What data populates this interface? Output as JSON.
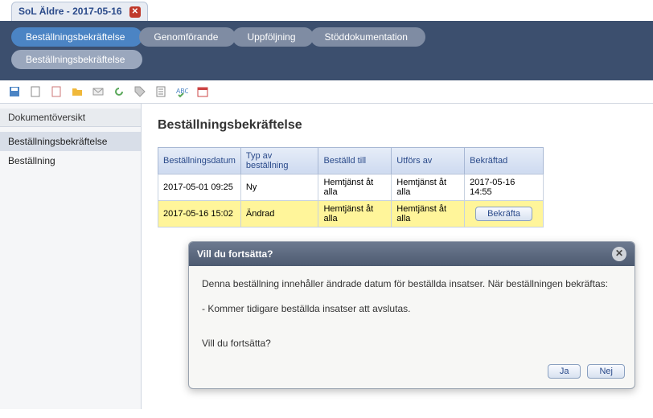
{
  "window": {
    "title": "SoL Äldre - 2017-05-16"
  },
  "nav": {
    "row1": [
      {
        "label": "Beställningsbekräftelse",
        "active": true
      },
      {
        "label": "Genomförande"
      },
      {
        "label": "Uppföljning"
      },
      {
        "label": "Stöddokumentation"
      }
    ],
    "row2": [
      {
        "label": "Beställningsbekräftelse",
        "active": true
      }
    ]
  },
  "sidebar": {
    "header": "Dokumentöversikt",
    "items": [
      {
        "label": "Beställningsbekräftelse",
        "selected": true
      },
      {
        "label": "Beställning"
      }
    ]
  },
  "page": {
    "title": "Beställningsbekräftelse"
  },
  "table": {
    "headers": [
      "Beställningsdatum",
      "Typ av beställning",
      "Beställd till",
      "Utförs av",
      "Bekräftad"
    ],
    "rows": [
      {
        "cells": [
          "2017-05-01 09:25",
          "Ny",
          "Hemtjänst åt alla",
          "Hemtjänst åt alla",
          "2017-05-16 14:55"
        ],
        "highlight": false
      },
      {
        "cells": [
          "2017-05-16 15:02",
          "Ändrad",
          "Hemtjänst åt alla",
          "Hemtjänst åt alla",
          ""
        ],
        "highlight": true,
        "action": "Bekräfta"
      }
    ]
  },
  "dialog": {
    "title": "Vill du fortsätta?",
    "line1": "Denna beställning innehåller ändrade datum för beställda insatser. När beställningen bekräftas:",
    "line2": "- Kommer tidigare beställda insatser att avslutas.",
    "line3": "Vill du fortsätta?",
    "yes": "Ja",
    "no": "Nej"
  }
}
